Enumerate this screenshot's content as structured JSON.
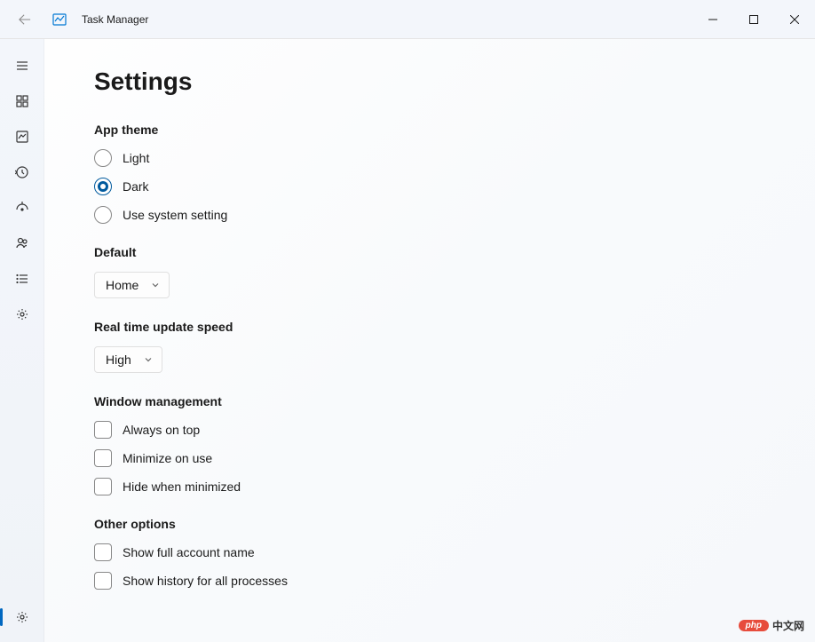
{
  "titlebar": {
    "app_name": "Task Manager"
  },
  "page": {
    "heading": "Settings"
  },
  "theme": {
    "section_label": "App theme",
    "options": {
      "light": "Light",
      "dark": "Dark",
      "system": "Use system setting"
    },
    "selected": "dark"
  },
  "default_page": {
    "section_label": "Default",
    "value": "Home"
  },
  "update_speed": {
    "section_label": "Real time update speed",
    "value": "High"
  },
  "window_mgmt": {
    "section_label": "Window management",
    "options": {
      "always_top": "Always on top",
      "min_on_use": "Minimize on use",
      "hide_min": "Hide when minimized"
    }
  },
  "other": {
    "section_label": "Other options",
    "options": {
      "full_name": "Show full account name",
      "history": "Show history for all processes"
    }
  },
  "watermark": {
    "badge": "php",
    "text": "中文网"
  }
}
